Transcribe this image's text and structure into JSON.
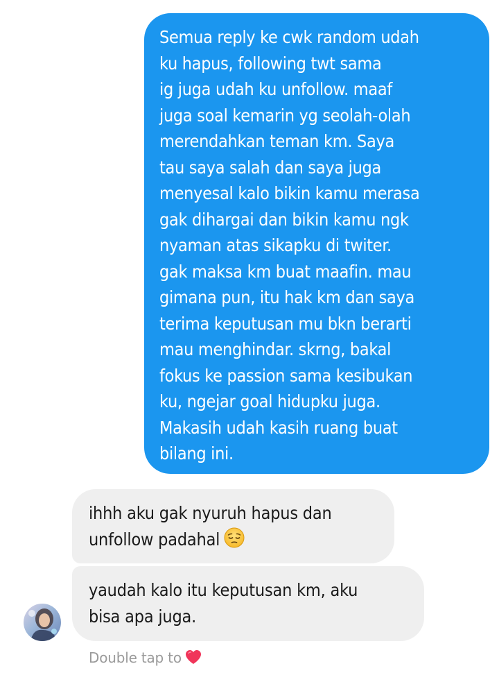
{
  "thread": {
    "sent": {
      "lines": [
        "Semua reply ke cwk random udah",
        "ku hapus, following twt sama",
        "ig juga udah ku unfollow. maaf",
        "juga soal kemarin yg seolah-olah",
        "merendahkan teman km. Saya",
        "tau saya salah dan saya juga",
        "menyesal kalo bikin kamu merasa",
        "gak dihargai dan bikin kamu ngk",
        "nyaman atas sikapku di twiter.",
        "gak maksa km buat maafin. mau",
        "gimana pun, itu hak km dan saya",
        "terima keputusan mu bkn berarti",
        "mau menghindar. skrng, bakal",
        "fokus ke passion sama kesibukan",
        "ku, ngejar goal hidupku juga.",
        "Makasih udah kasih ruang buat",
        "bilang ini."
      ]
    },
    "received": [
      {
        "lines": [
          "ihhh aku gak nyuruh hapus dan",
          "unfollow padahal"
        ],
        "emoji": "pensive-face-icon"
      },
      {
        "lines": [
          "yaudah kalo itu keputusan km, aku",
          "bisa apa juga."
        ]
      }
    ],
    "hint": {
      "text": "Double tap to",
      "icon": "heart-icon"
    }
  },
  "colors": {
    "sent_bubble": "#1b96ef",
    "received_bubble": "#efefef",
    "hint_text": "#9a9a9a",
    "heart": "#f0355a"
  }
}
